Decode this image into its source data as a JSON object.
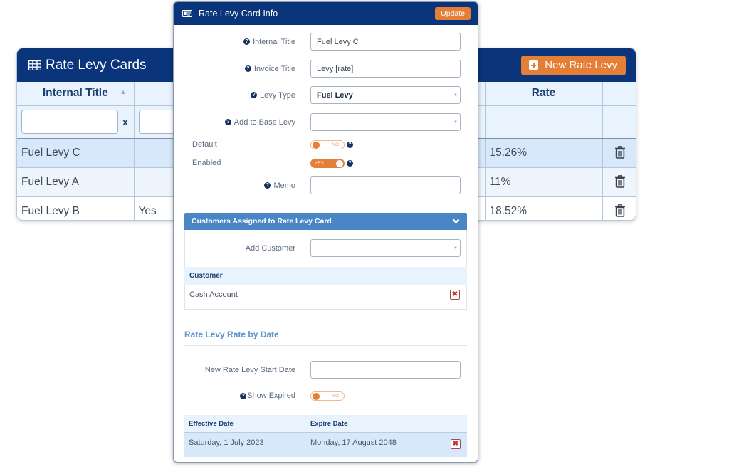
{
  "table_card": {
    "title": "Rate Levy Cards",
    "title_icon": "table-grid-icon",
    "new_button_label": "New Rate Levy",
    "new_button_icon": "plus-square-icon",
    "columns": [
      "Internal Title",
      "",
      "Rate",
      ""
    ],
    "sort_indicator": "▲",
    "filter_clear_label": "x",
    "rows": [
      {
        "internal_title": "Fuel Levy C",
        "col2": "",
        "rate": "15.26%",
        "action_icon": "trash-icon"
      },
      {
        "internal_title": "Fuel Levy A",
        "col2": "",
        "rate": "11%",
        "action_icon": "trash-icon"
      },
      {
        "internal_title": "Fuel Levy B",
        "col2": "Yes",
        "rate": "18.52%",
        "action_icon": "trash-icon"
      }
    ]
  },
  "modal": {
    "title": "Rate Levy Card Info",
    "title_icon": "id-card-icon",
    "update_label": "Update",
    "fields": {
      "internal_title": {
        "label": "Internal Title",
        "value": "Fuel Levy C"
      },
      "invoice_title": {
        "label": "Invoice Title",
        "value": "Levy [rate]"
      },
      "levy_type": {
        "label": "Levy Type",
        "value": "Fuel Levy"
      },
      "add_to_base_levy": {
        "label": "Add to Base Levy",
        "value": ""
      },
      "default": {
        "label": "Default",
        "state": "NO"
      },
      "enabled": {
        "label": "Enabled",
        "state": "YES"
      },
      "memo": {
        "label": "Memo",
        "value": ""
      }
    },
    "help_glyph": "?",
    "select_arrow": "▼",
    "customers_section": {
      "title": "Customers Assigned to Rate Levy Card",
      "add_label": "Add Customer",
      "add_value": "",
      "column": "Customer",
      "rows": [
        {
          "name": "Cash Account"
        }
      ],
      "delete_glyph": "✖"
    },
    "rate_by_date": {
      "title": "Rate Levy Rate by Date",
      "start_date_label": "New Rate Levy Start Date",
      "start_date_value": "",
      "show_expired_label": "Show Expired",
      "show_expired_state": "NO",
      "columns": [
        "Effective Date",
        "Expire Date"
      ],
      "rows": [
        {
          "effective": "Saturday, 1 July 2023",
          "expire": "Monday, 17 August 2048"
        }
      ]
    }
  },
  "colors": {
    "navy": "#0b357a",
    "orange": "#e57f38",
    "section_blue": "#4a86c5",
    "header_tint": "#e8f3fd",
    "selected_row": "#d6e8fa"
  }
}
